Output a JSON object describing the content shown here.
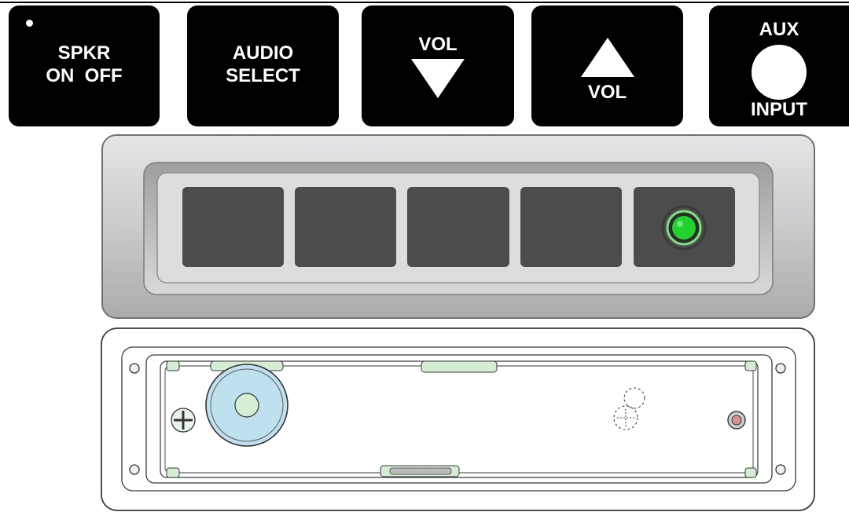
{
  "keys": [
    {
      "line1": "SPKR",
      "line2": "ON  OFF"
    },
    {
      "line1": "AUDIO",
      "line2": "SELECT"
    },
    {
      "label": "VOL"
    },
    {
      "label": "VOL"
    },
    {
      "top": "AUX",
      "bottom": "INPUT"
    }
  ],
  "colors": {
    "key_bg": "#000000",
    "bezel": "#c8cacb",
    "slot": "#4c4c4c",
    "led": "#23d12e",
    "speaker": "#bfe0ef"
  },
  "icons": [
    "indicator-dot-icon",
    "volume-down-triangle-icon",
    "volume-up-triangle-icon",
    "aux-jack-icon",
    "screw-icon",
    "speaker-icon"
  ]
}
